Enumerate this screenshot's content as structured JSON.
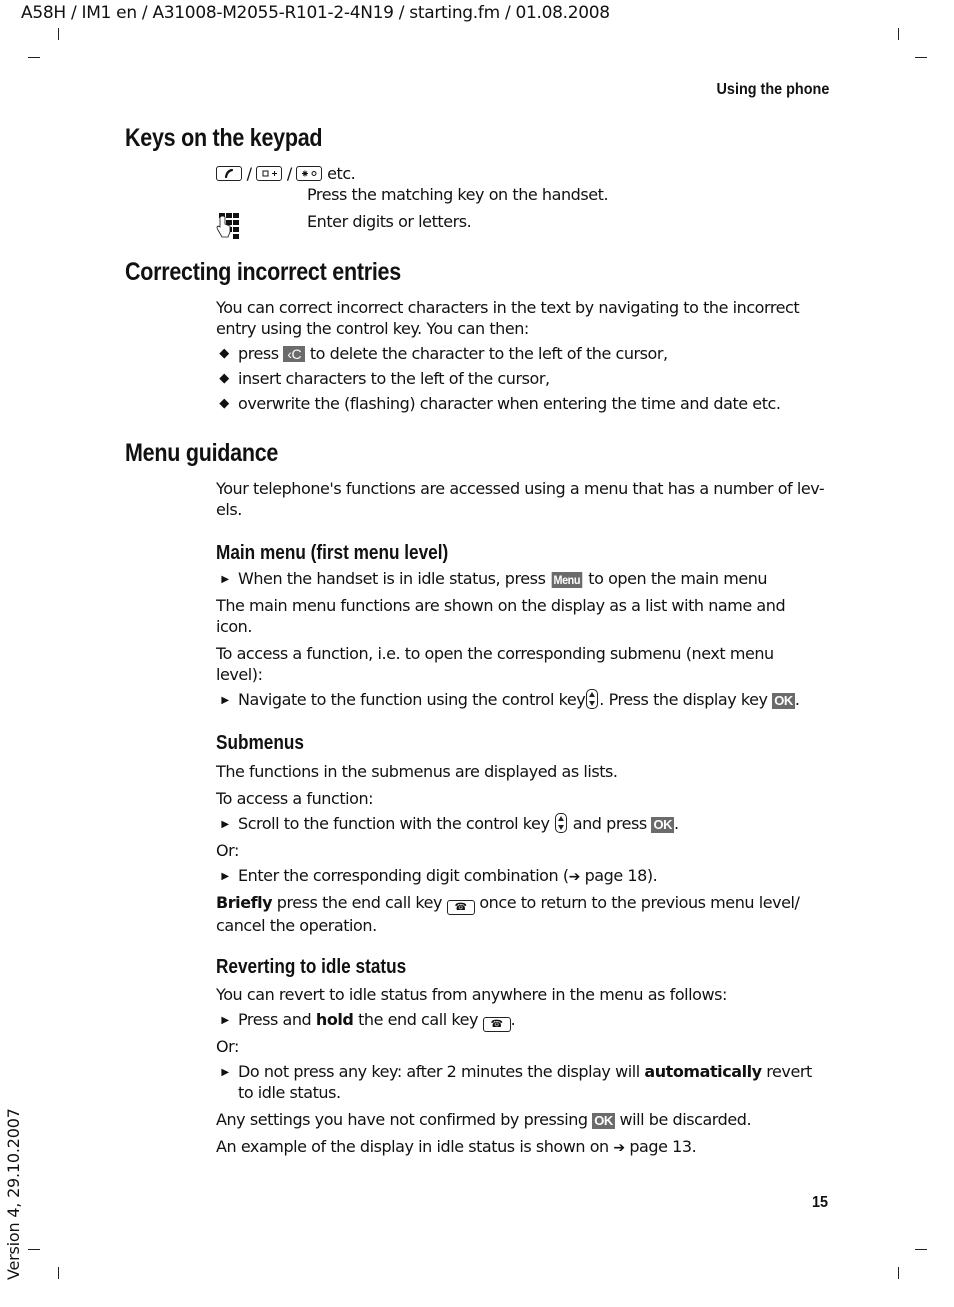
{
  "header": {
    "meta": "A58H / IM1 en / A31008-M2055-R101-2-4N19 / starting.fm / 01.08.2008",
    "running_head": "Using the phone"
  },
  "footer": {
    "page_number": "15",
    "version": "Version 4, 29.10.2007"
  },
  "sections": {
    "keys": {
      "title": "Keys on the keypad",
      "row1_sep": "/",
      "row1_etc": "etc.",
      "row1_desc": "Press the matching key on the handset.",
      "row2_desc": "Enter digits or letters.",
      "icons": [
        "talk-key-icon",
        "key-0-icon",
        "star-key-icon",
        "keypad-hand-icon"
      ]
    },
    "correcting": {
      "title": "Correcting incorrect entries",
      "intro_1": "You can correct incorrect characters in the text by navigating to the incorrect",
      "intro_2": "entry using the control key. You can then:",
      "bullets": [
        {
          "pre": "press",
          "key": "‹C",
          "post": "to delete the character to the left of the cursor,"
        },
        {
          "text": "insert characters to the left of the cursor,"
        },
        {
          "text": "overwrite the (flashing) character when entering the time and date etc."
        }
      ]
    },
    "menu": {
      "title": "Menu guidance",
      "intro_1": "Your telephone's functions are accessed using a menu that has a number of lev-",
      "intro_2": "els.",
      "main_menu": {
        "title": "Main menu (first menu level)",
        "step1_pre": "When the handset is in idle status, press",
        "step1_key": "Menu",
        "step1_post": "to open the main menu",
        "para1_1": "The main menu functions are shown on the display as a list with name and",
        "para1_2": "icon.",
        "para2_1": "To access a function, i.e. to open the corresponding submenu (next menu",
        "para2_2": "level):",
        "step2_pre": "Navigate to the function using the control key",
        "step2_mid": ". Press the display key",
        "step2_key": "OK",
        "step2_post": "."
      },
      "submenus": {
        "title": "Submenus",
        "para1": "The functions in the submenus are displayed as lists.",
        "para2": "To access a function:",
        "step1_pre": "Scroll to the function with the control key",
        "step1_mid": "and press",
        "step1_key": "OK",
        "step1_post": ".",
        "or": "Or:",
        "step2_pre": "Enter the corresponding digit combination (",
        "step2_arrow": "➔",
        "step2_post": "page 18).",
        "note_bold": "Briefly",
        "note_pre": "press the end call key",
        "note_post_1": "once to return to the previous menu level/",
        "note_post_2": "cancel the operation."
      },
      "reverting": {
        "title": "Reverting to idle status",
        "para1": "You can revert to idle status from anywhere in the menu as follows:",
        "step1_pre": "Press and",
        "step1_bold": "hold",
        "step1_mid": "the end call key",
        "step1_post": ".",
        "or": "Or:",
        "step2_pre": "Do not press any key: after 2 minutes the display will",
        "step2_bold": "automatically",
        "step2_post": "revert",
        "step2_line2": "to idle status.",
        "para2_pre": "Any settings you have not confirmed by pressing",
        "para2_key": "OK",
        "para2_post": "will be discarded.",
        "para3_pre": "An example of the display in idle status is shown on",
        "para3_arrow": "➔",
        "para3_post": "page 13."
      }
    }
  },
  "glyphs": {
    "diamond": "◆",
    "triangle": "▶",
    "end_key": "☎"
  }
}
